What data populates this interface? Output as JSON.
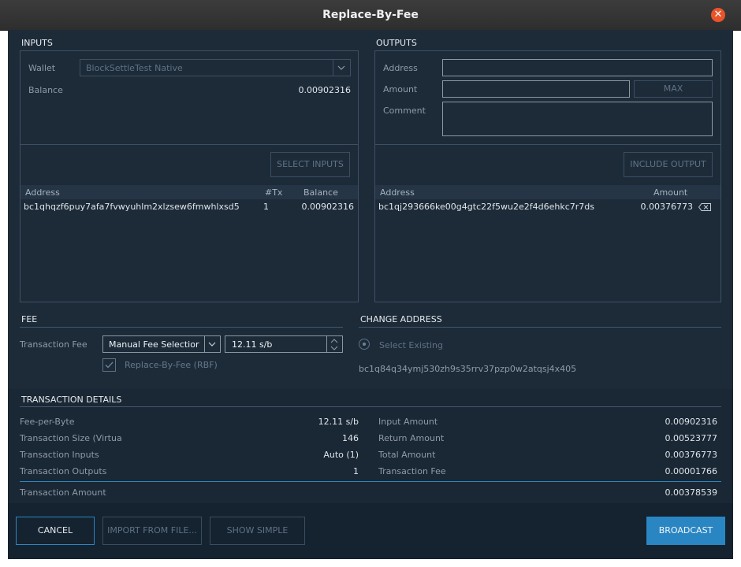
{
  "window": {
    "title": "Replace-By-Fee"
  },
  "inputs": {
    "section_title": "INPUTS",
    "wallet_label": "Wallet",
    "wallet_value": "BlockSettleTest Native",
    "balance_label": "Balance",
    "balance_value": "0.00902316",
    "select_inputs_label": "SELECT INPUTS",
    "table": {
      "headers": [
        "Address",
        "#Tx",
        "Balance"
      ],
      "rows": [
        {
          "address": "bc1qhqzf6puy7afa7fvwyuhlm2xlzsew6fmwhlxsd5",
          "tx": "1",
          "balance": "0.00902316"
        }
      ]
    }
  },
  "outputs": {
    "section_title": "OUTPUTS",
    "address_label": "Address",
    "amount_label": "Amount",
    "max_label": "MAX",
    "comment_label": "Comment",
    "include_output_label": "INCLUDE OUTPUT",
    "table": {
      "headers": [
        "Address",
        "Amount"
      ],
      "rows": [
        {
          "address": "bc1qj293666ke00g4gtc22f5wu2e2f4d6ehkc7r7ds",
          "amount": "0.00376773"
        }
      ]
    }
  },
  "fee": {
    "section_title": "FEE",
    "transaction_fee_label": "Transaction Fee",
    "fee_selection_value": "Manual Fee Selectior",
    "fee_rate_value": "12.11 s/b",
    "rbf_label": "Replace-By-Fee (RBF)",
    "rbf_checked": true
  },
  "change_address": {
    "section_title": "CHANGE ADDRESS",
    "select_existing_label": "Select Existing",
    "address_value": "bc1q84q34ymj530zh9s35rrv37pzp0w2atqsj4x405"
  },
  "details": {
    "section_title": "TRANSACTION DETAILS",
    "left": [
      {
        "label": "Fee-per-Byte",
        "value": "12.11 s/b"
      },
      {
        "label": "Transaction Size (Virtua",
        "value": "146"
      },
      {
        "label": "Transaction Inputs",
        "value": "Auto (1)"
      },
      {
        "label": "Transaction Outputs",
        "value": "1"
      }
    ],
    "right": [
      {
        "label": "Input Amount",
        "value": "0.00902316"
      },
      {
        "label": "Return Amount",
        "value": "0.00523777"
      },
      {
        "label": "Total Amount",
        "value": "0.00376773"
      },
      {
        "label": "Transaction Fee",
        "value": "0.00001766"
      }
    ],
    "transaction_amount_label": "Transaction Amount",
    "transaction_amount_value": "0.00378539"
  },
  "buttons": {
    "cancel": "CANCEL",
    "import": "IMPORT FROM FILE...",
    "show_simple": "SHOW SIMPLE",
    "broadcast": "BROADCAST"
  },
  "colors": {
    "background": "#1d2b39",
    "accent": "#2a86c2",
    "close": "#e9542a"
  }
}
